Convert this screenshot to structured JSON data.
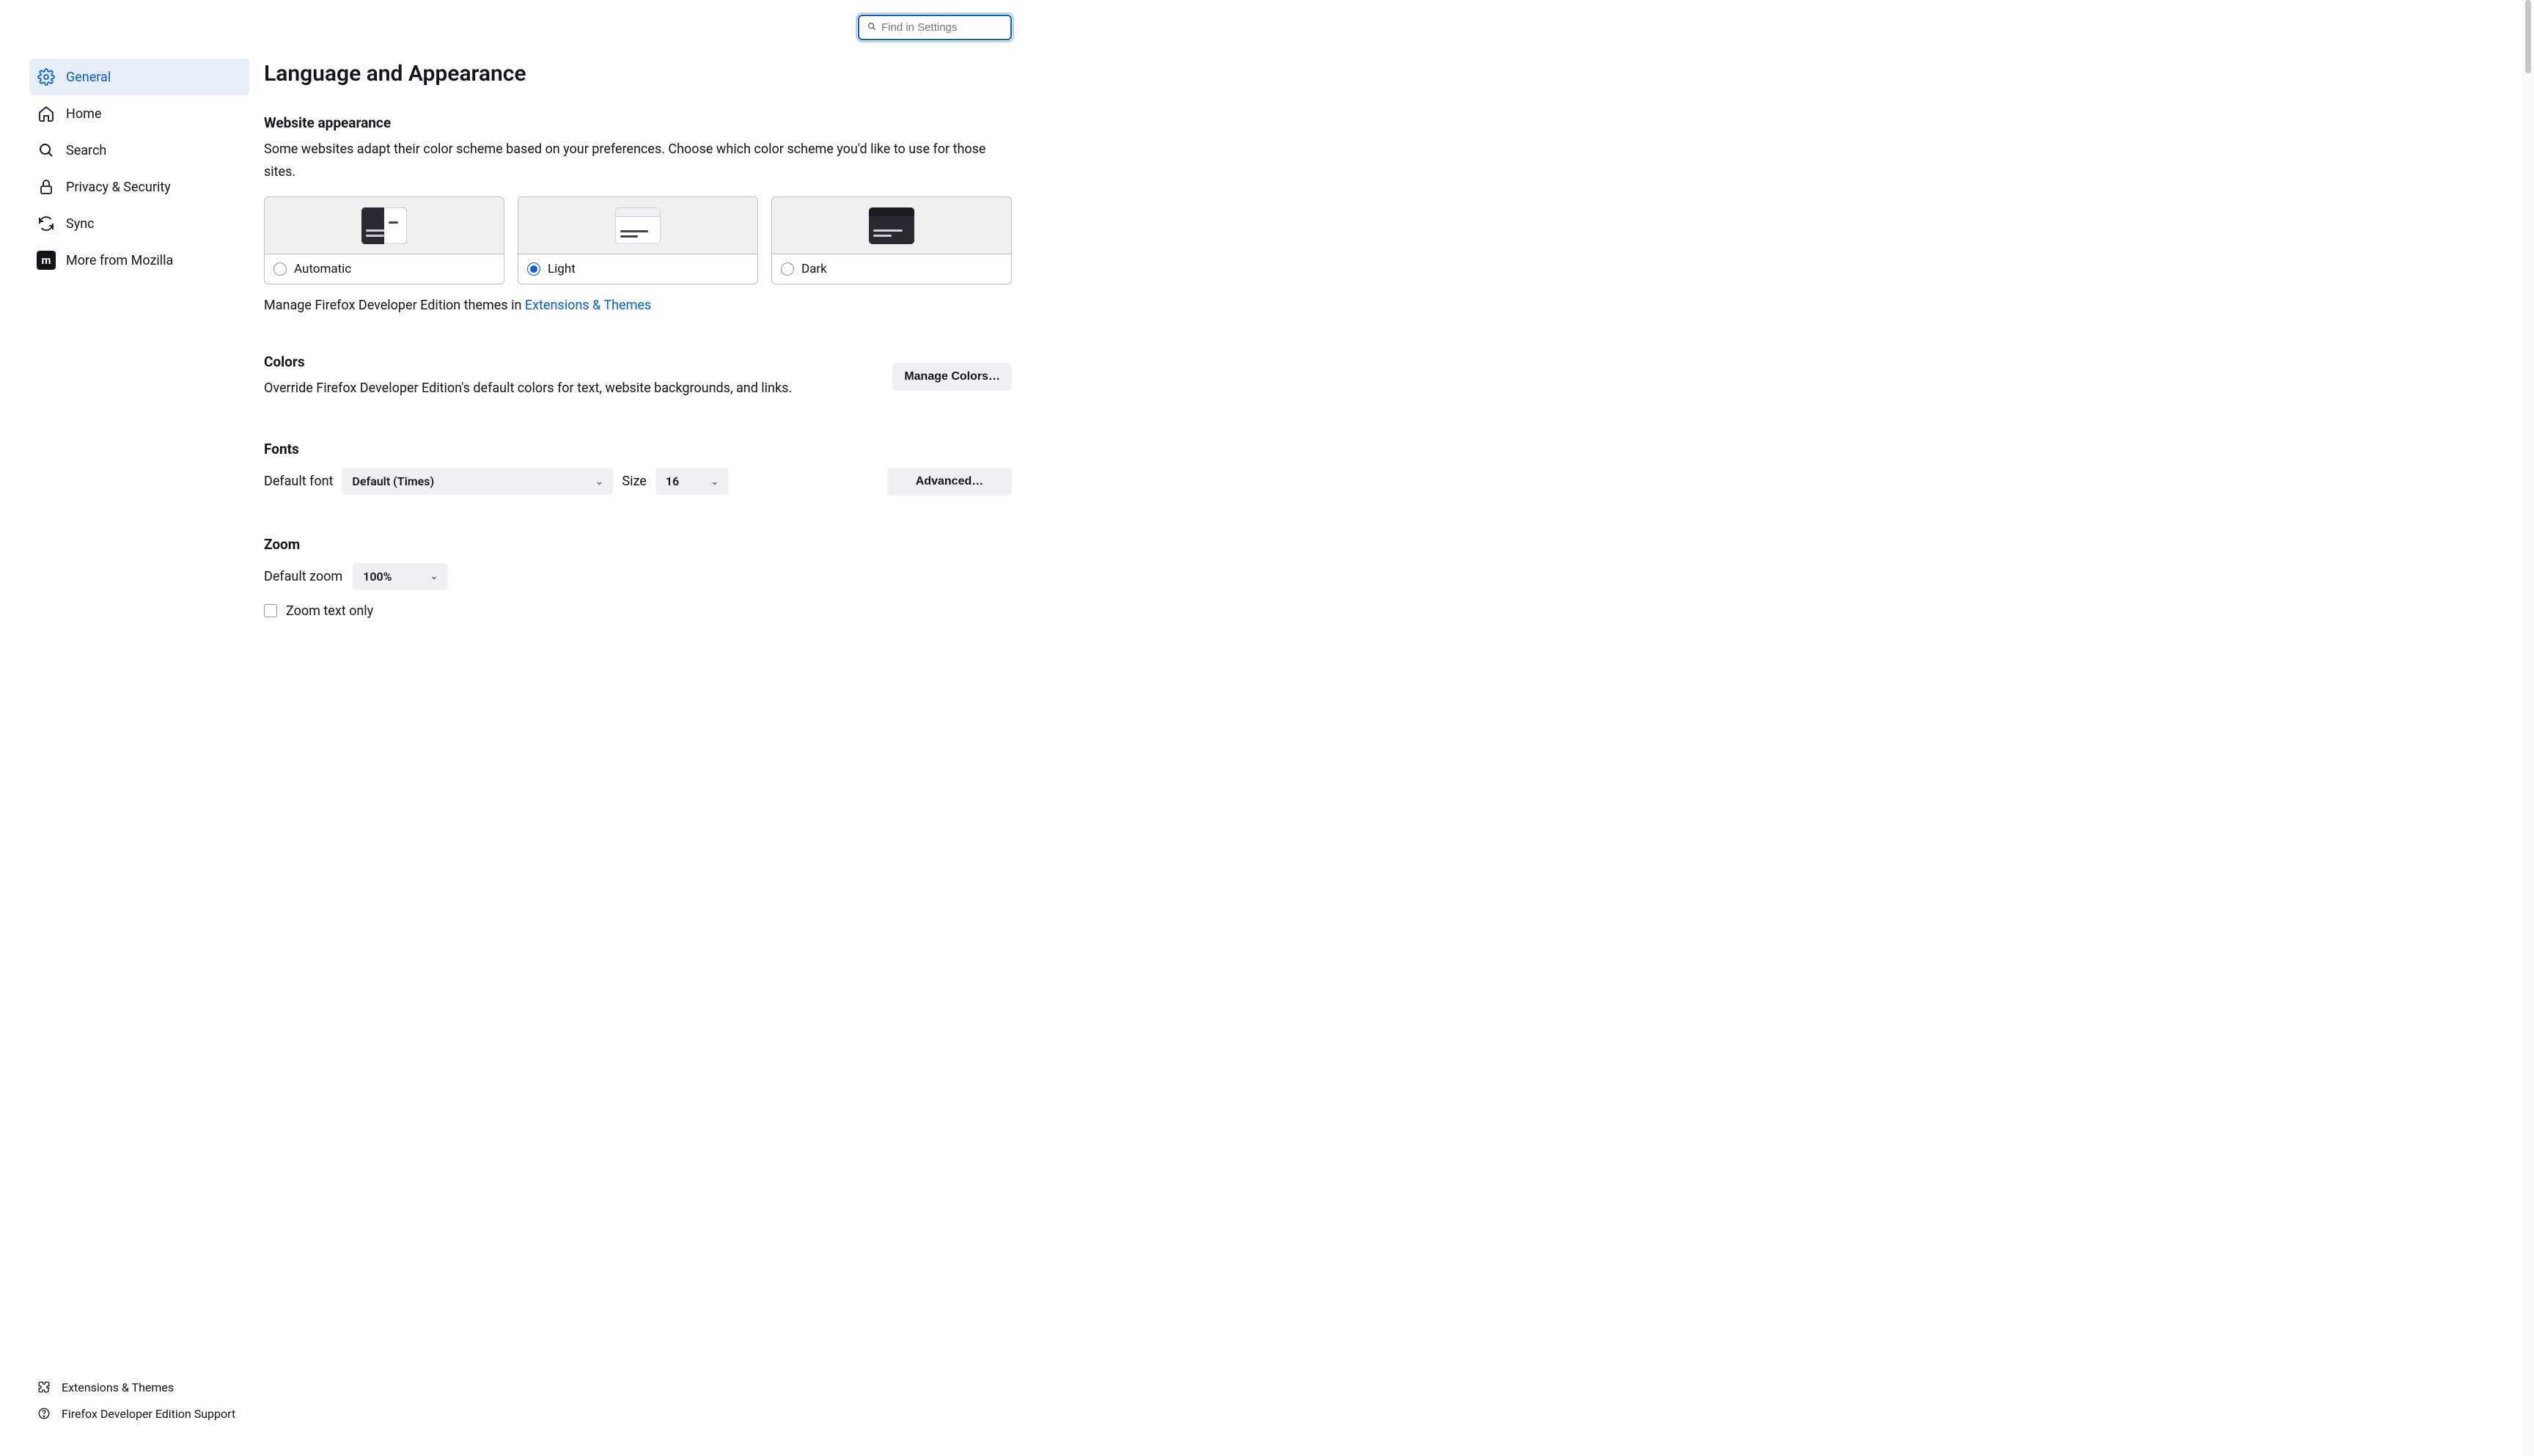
{
  "search": {
    "placeholder": "Find in Settings"
  },
  "sidebar": {
    "items": [
      {
        "label": "General"
      },
      {
        "label": "Home"
      },
      {
        "label": "Search"
      },
      {
        "label": "Privacy & Security"
      },
      {
        "label": "Sync"
      },
      {
        "label": "More from Mozilla"
      }
    ],
    "footer": [
      {
        "label": "Extensions & Themes"
      },
      {
        "label": "Firefox Developer Edition Support"
      }
    ]
  },
  "page": {
    "title": "Language and Appearance"
  },
  "appearance": {
    "heading": "Website appearance",
    "desc": "Some websites adapt their color scheme based on your preferences. Choose which color scheme you'd like to use for those sites.",
    "options": [
      {
        "label": "Automatic"
      },
      {
        "label": "Light"
      },
      {
        "label": "Dark"
      }
    ],
    "themes_prefix": "Manage Firefox Developer Edition themes in ",
    "themes_link": "Extensions & Themes"
  },
  "colors": {
    "heading": "Colors",
    "desc": "Override Firefox Developer Edition's default colors for text, website backgrounds, and links.",
    "button": "Manage Colors…"
  },
  "fonts": {
    "heading": "Fonts",
    "default_font_label": "Default font",
    "default_font_value": "Default (Times)",
    "size_label": "Size",
    "size_value": "16",
    "advanced": "Advanced…"
  },
  "zoom": {
    "heading": "Zoom",
    "default_zoom_label": "Default zoom",
    "default_zoom_value": "100%",
    "text_only": "Zoom text only"
  }
}
